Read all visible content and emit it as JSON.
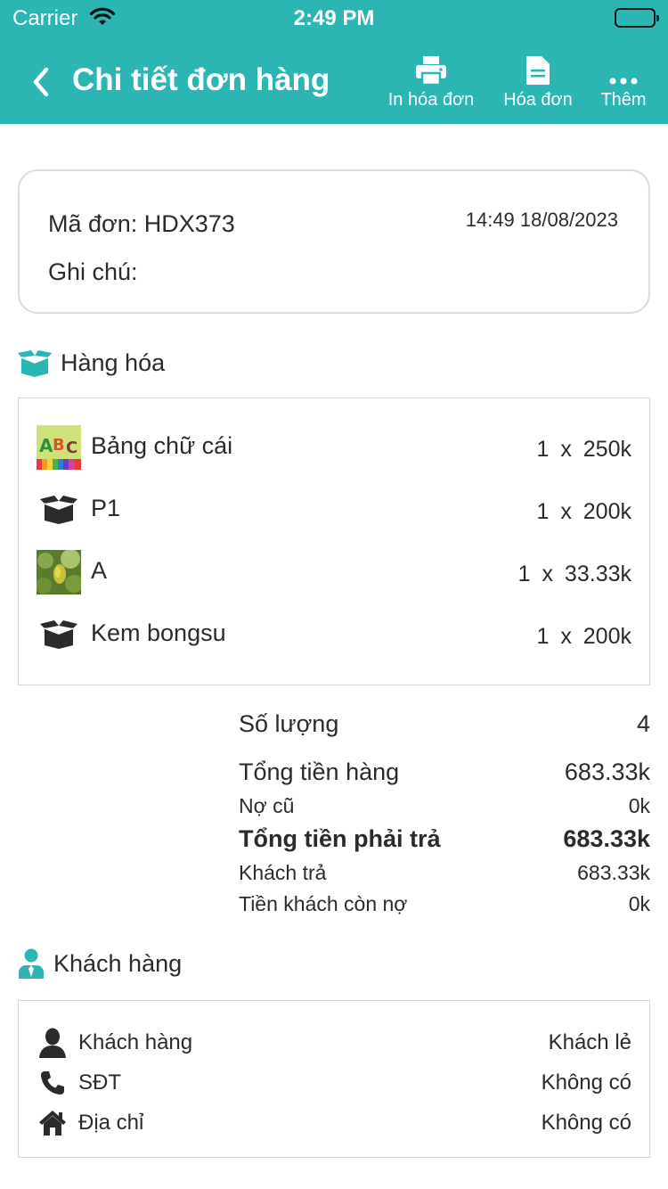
{
  "status_bar": {
    "carrier": "Carrier",
    "time": "2:49 PM"
  },
  "header": {
    "title": "Chi tiết đơn hàng",
    "actions": {
      "print": "In hóa đơn",
      "invoice": "Hóa đơn",
      "more": "Thêm"
    }
  },
  "order": {
    "code": "Mã đơn: HDX373",
    "note": "Ghi chú:",
    "datetime": "14:49 18/08/2023"
  },
  "goods": {
    "heading": "Hàng hóa",
    "items": [
      {
        "name": "Bảng chữ cái",
        "qty_price": "1 x 250k",
        "thumb": "alphabet-image"
      },
      {
        "name": "P1",
        "qty_price": "1 x 200k",
        "thumb": "box-icon"
      },
      {
        "name": "A",
        "qty_price": "1 x 33.33k",
        "thumb": "plant-photo"
      },
      {
        "name": "Kem bongsu",
        "qty_price": "1 x 200k",
        "thumb": "box-icon"
      }
    ]
  },
  "summary": {
    "quantity_label": "Số lượng",
    "quantity_value": "4",
    "subtotal_label": "Tổng tiền hàng",
    "subtotal_value": "683.33k",
    "old_debt_label": "Nợ cũ",
    "old_debt_value": "0k",
    "total_label": "Tổng tiền phải trả",
    "total_value": "683.33k",
    "paid_label": "Khách trả",
    "paid_value": "683.33k",
    "remaining_label": "Tiền khách còn nợ",
    "remaining_value": "0k"
  },
  "customer": {
    "heading": "Khách hàng",
    "rows": [
      {
        "label": "Khách hàng",
        "value": "Khách lẻ",
        "icon": "person-icon"
      },
      {
        "label": "SĐT",
        "value": "Không có",
        "icon": "phone-icon"
      },
      {
        "label": "Địa chỉ",
        "value": "Không có",
        "icon": "home-icon"
      }
    ]
  },
  "colors": {
    "primary": "#2bb5b3",
    "text": "#2b2b2b",
    "border": "#dcdcdc"
  }
}
